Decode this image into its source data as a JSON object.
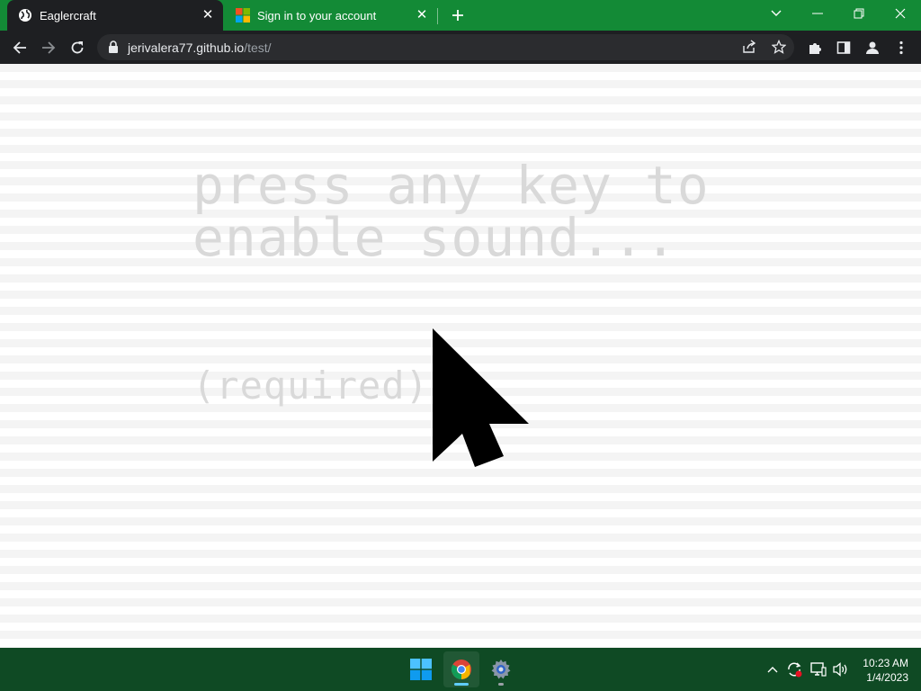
{
  "browser": {
    "tabs": [
      {
        "label": "Eaglercraft",
        "active": true,
        "icon": "globe-icon"
      },
      {
        "label": "Sign in to your account",
        "active": false,
        "icon": "microsoft-logo-icon"
      }
    ],
    "newtab_icon": "plus-icon",
    "window_controls": [
      "chevron-down-icon",
      "minimize-icon",
      "restore-icon",
      "close-icon"
    ],
    "url": {
      "host": "jerivalera77.github.io",
      "path": "/test/"
    },
    "colors": {
      "frame": "#138a36",
      "toolbar": "#1e1f22",
      "omnibox": "#2b2c2f"
    }
  },
  "page": {
    "line1": "press any key to",
    "line2": "enable sound...",
    "required": "(required)"
  },
  "taskbar": {
    "apps": [
      "windows-start-icon",
      "chrome-icon",
      "settings-icon"
    ],
    "tray": [
      "chevron-up-icon",
      "sync-icon",
      "network-icon",
      "volume-icon"
    ],
    "time": "10:23 AM",
    "date": "1/4/2023"
  }
}
